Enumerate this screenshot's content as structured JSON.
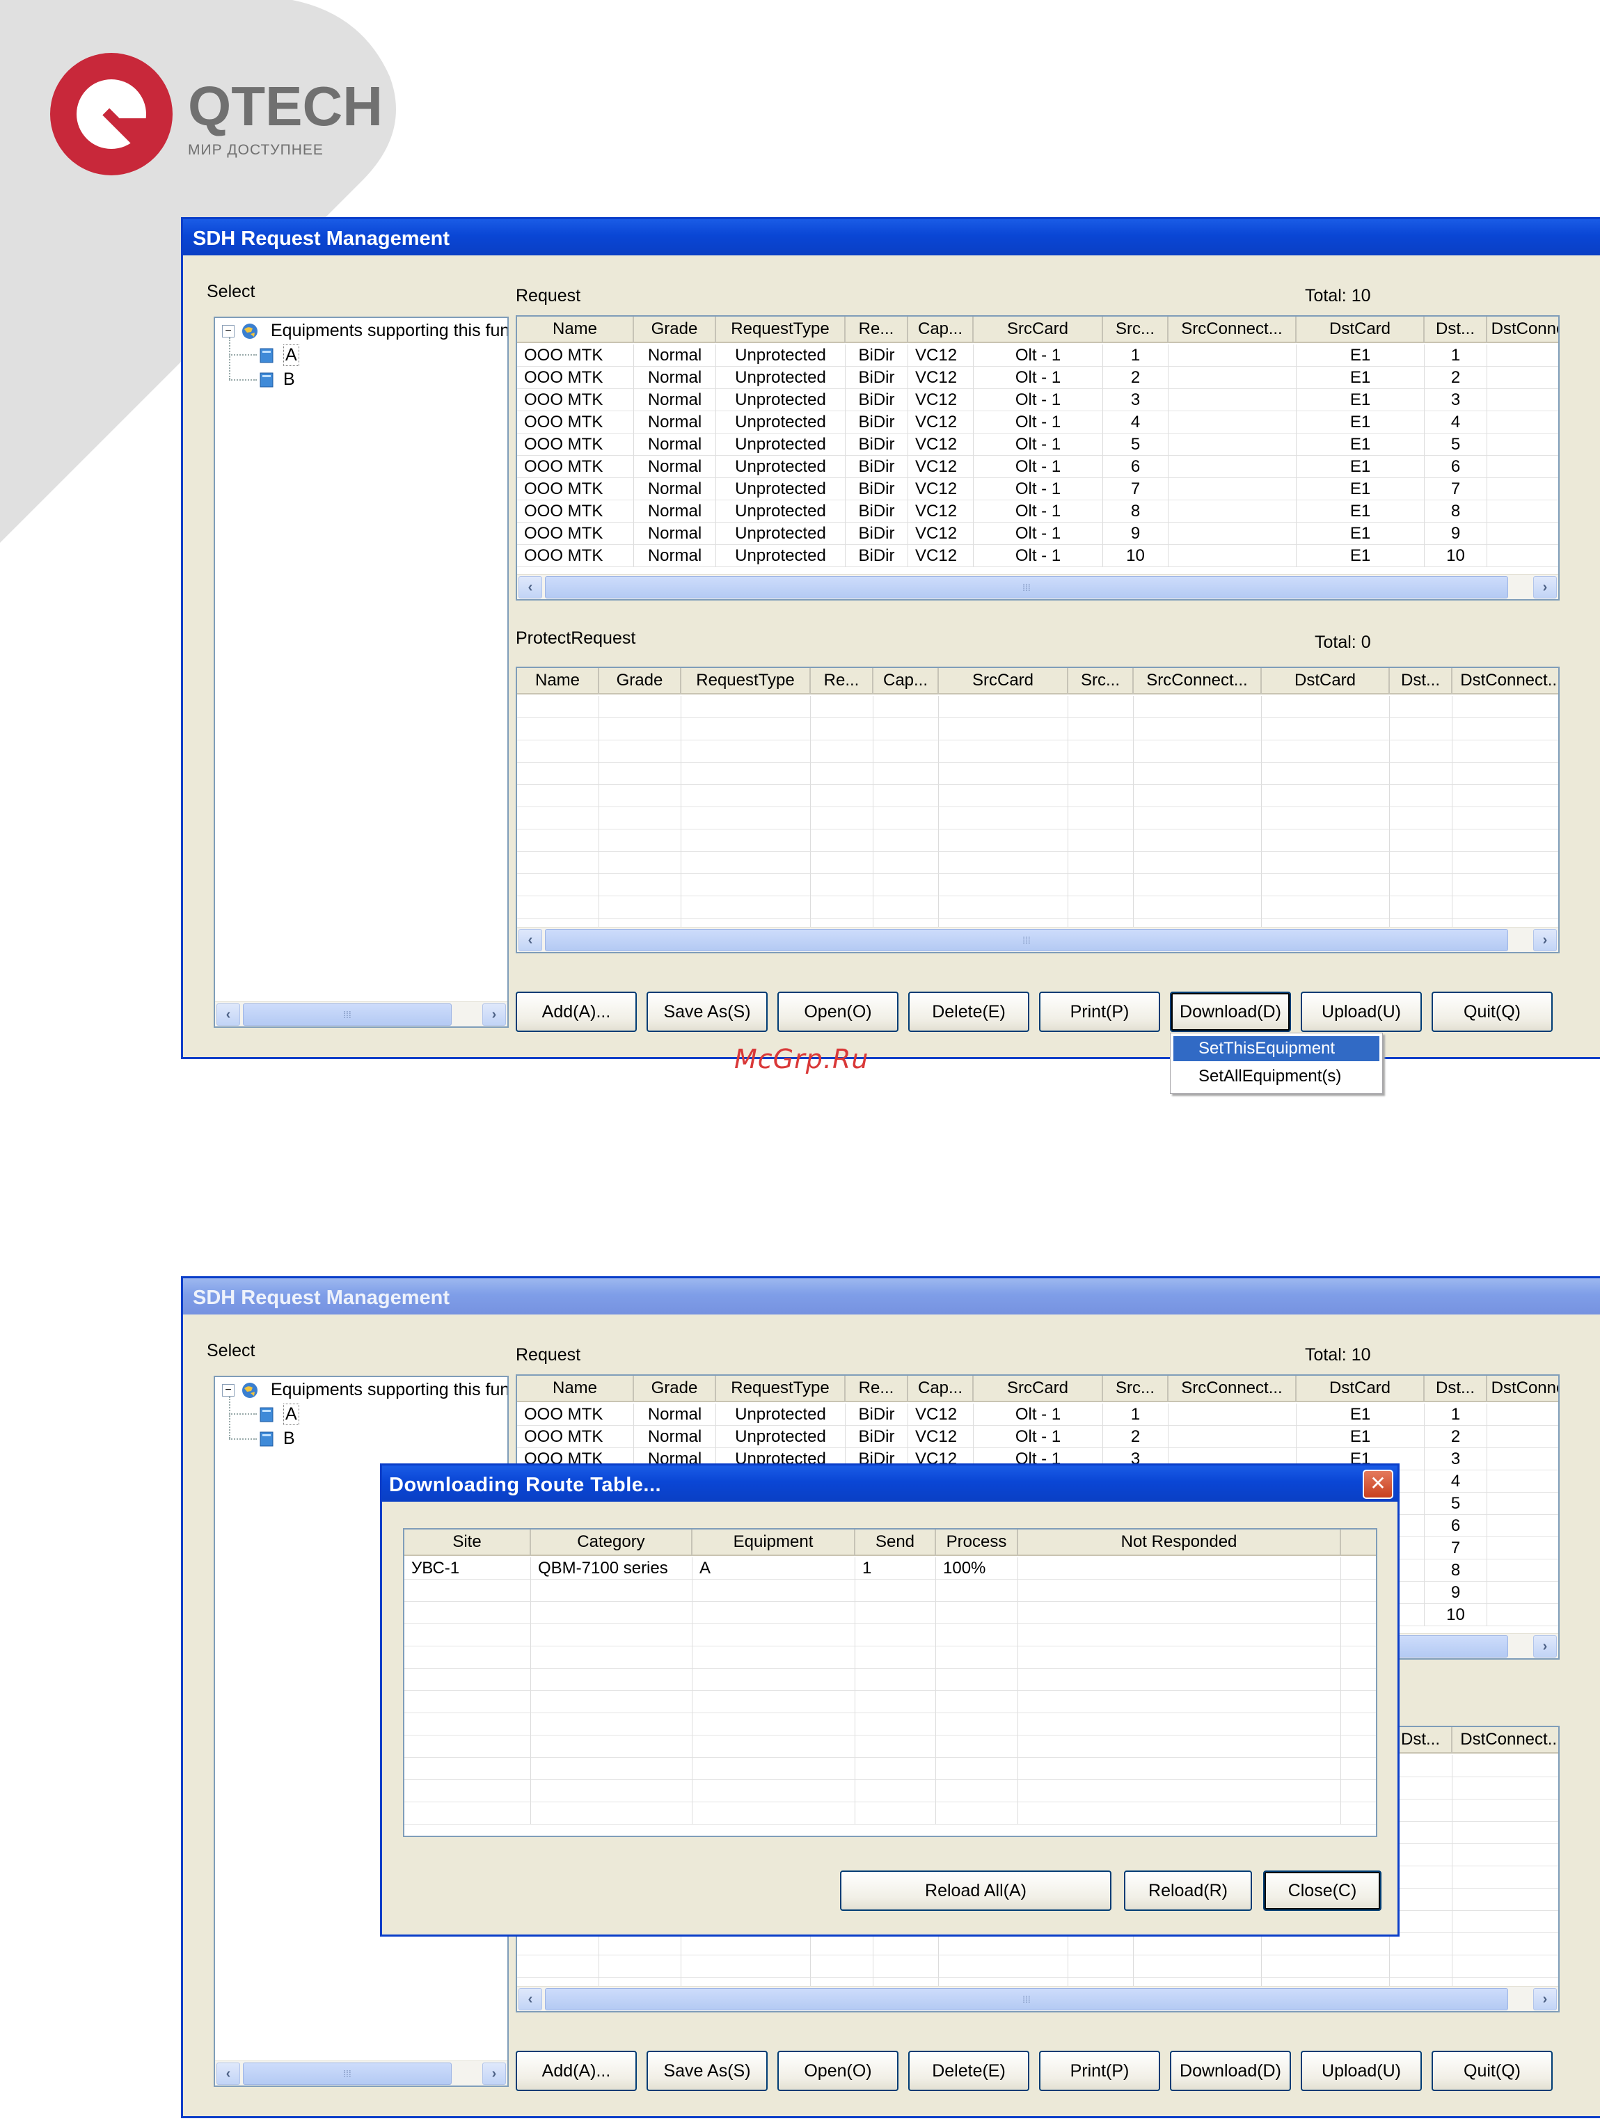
{
  "logo": {
    "name": "QTECH",
    "tagline": "МИР ДОСТУПНЕЕ"
  },
  "watermark": "McGrp.Ru",
  "colors": {
    "title_blue": "#0a46d5",
    "logo_red": "#c8283a",
    "logo_gray": "#707070",
    "selection": "#316ac5"
  },
  "window": {
    "title": "SDH Request Management",
    "select_label": "Select",
    "tree": {
      "root": "Equipments supporting this fun",
      "children": [
        "A",
        "B"
      ]
    },
    "request": {
      "label": "Request",
      "total": "Total: 10",
      "columns": [
        "Name",
        "Grade",
        "RequestType",
        "Re...",
        "Cap...",
        "SrcCard",
        "Src...",
        "SrcConnect...",
        "DstCard",
        "Dst...",
        "DstConne"
      ],
      "rows": [
        [
          "OOO MTK",
          "Normal",
          "Unprotected",
          "BiDir",
          "VC12",
          "Olt - 1",
          "1",
          "",
          "E1",
          "1",
          ""
        ],
        [
          "OOO MTK",
          "Normal",
          "Unprotected",
          "BiDir",
          "VC12",
          "Olt - 1",
          "2",
          "",
          "E1",
          "2",
          ""
        ],
        [
          "OOO MTK",
          "Normal",
          "Unprotected",
          "BiDir",
          "VC12",
          "Olt - 1",
          "3",
          "",
          "E1",
          "3",
          ""
        ],
        [
          "OOO MTK",
          "Normal",
          "Unprotected",
          "BiDir",
          "VC12",
          "Olt - 1",
          "4",
          "",
          "E1",
          "4",
          ""
        ],
        [
          "OOO MTK",
          "Normal",
          "Unprotected",
          "BiDir",
          "VC12",
          "Olt - 1",
          "5",
          "",
          "E1",
          "5",
          ""
        ],
        [
          "OOO MTK",
          "Normal",
          "Unprotected",
          "BiDir",
          "VC12",
          "Olt - 1",
          "6",
          "",
          "E1",
          "6",
          ""
        ],
        [
          "OOO MTK",
          "Normal",
          "Unprotected",
          "BiDir",
          "VC12",
          "Olt - 1",
          "7",
          "",
          "E1",
          "7",
          ""
        ],
        [
          "OOO MTK",
          "Normal",
          "Unprotected",
          "BiDir",
          "VC12",
          "Olt - 1",
          "8",
          "",
          "E1",
          "8",
          ""
        ],
        [
          "OOO MTK",
          "Normal",
          "Unprotected",
          "BiDir",
          "VC12",
          "Olt - 1",
          "9",
          "",
          "E1",
          "9",
          ""
        ],
        [
          "OOO MTK",
          "Normal",
          "Unprotected",
          "BiDir",
          "VC12",
          "Olt - 1",
          "10",
          "",
          "E1",
          "10",
          ""
        ]
      ]
    },
    "protect": {
      "label": "ProtectRequest",
      "total": "Total: 0",
      "columns": [
        "Name",
        "Grade",
        "RequestType",
        "Re...",
        "Cap...",
        "SrcCard",
        "Src...",
        "SrcConnect...",
        "DstCard",
        "Dst...",
        "DstConnect..."
      ]
    },
    "buttons": [
      "Add(A)...",
      "Save As(S)",
      "Open(O)",
      "Delete(E)",
      "Print(P)",
      "Download(D)",
      "Upload(U)",
      "Quit(Q)"
    ],
    "download_menu": [
      "SetThisEquipment",
      "SetAllEquipment(s)"
    ]
  },
  "dialog": {
    "title": "Downloading Route Table...",
    "close_glyph": "✕",
    "columns": [
      "Site",
      "Category",
      "Equipment",
      "Send",
      "Process",
      "Not Responded"
    ],
    "rows": [
      [
        "УВС-1",
        "QBM-7100 series",
        "A",
        "1",
        "100%",
        ""
      ]
    ],
    "buttons": [
      "Reload All(A)",
      "Reload(R)",
      "Close(C)"
    ]
  }
}
